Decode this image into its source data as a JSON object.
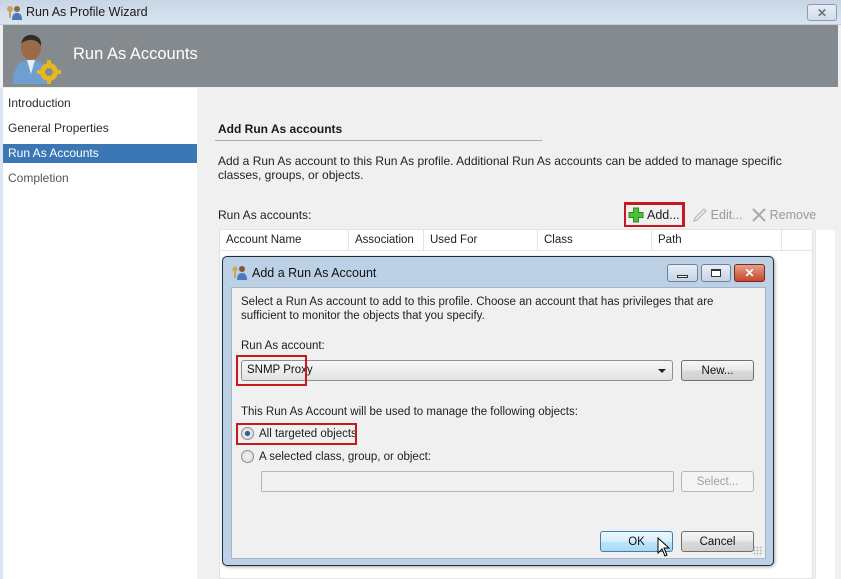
{
  "window": {
    "title": "Run As Profile Wizard",
    "close_symbol": "✕"
  },
  "banner": {
    "title": "Run As Accounts",
    "icon": "user-gear-icon"
  },
  "nav": {
    "items": [
      {
        "label": "Introduction",
        "state": "normal"
      },
      {
        "label": "General Properties",
        "state": "normal"
      },
      {
        "label": "Run As Accounts",
        "state": "active"
      },
      {
        "label": "Completion",
        "state": "normal"
      }
    ]
  },
  "main": {
    "section_title": "Add Run As accounts",
    "description": "Add a Run As account to this Run As profile.  Additional Run As accounts can be added to manage specific classes, groups, or objects.",
    "list_label": "Run As accounts:",
    "toolbar": {
      "add_label": "Add...",
      "edit_label": "Edit...",
      "remove_label": "Remove"
    },
    "grid": {
      "columns": [
        "Account Name",
        "Association",
        "Used For",
        "Class",
        "Path"
      ],
      "rows": []
    }
  },
  "dialog": {
    "title": "Add a Run As Account",
    "description": "Select a Run As account to add to this profile.  Choose an account that has privileges that are sufficient to monitor the objects that you specify.",
    "account_label": "Run As account:",
    "account_value": "SNMP Proxy",
    "new_button": "New...",
    "objects_label": "This Run As Account will be used to manage the following objects:",
    "options": [
      {
        "label": "All targeted objects",
        "checked": true
      },
      {
        "label": "A selected class, group, or object:",
        "checked": false
      }
    ],
    "selected_object_value": "",
    "select_button": "Select...",
    "ok_button": "OK",
    "cancel_button": "Cancel",
    "close_symbol": "✕"
  },
  "colors": {
    "highlight": "#c8181f",
    "nav_active": "#3b77b4",
    "banner": "#858a8e"
  }
}
